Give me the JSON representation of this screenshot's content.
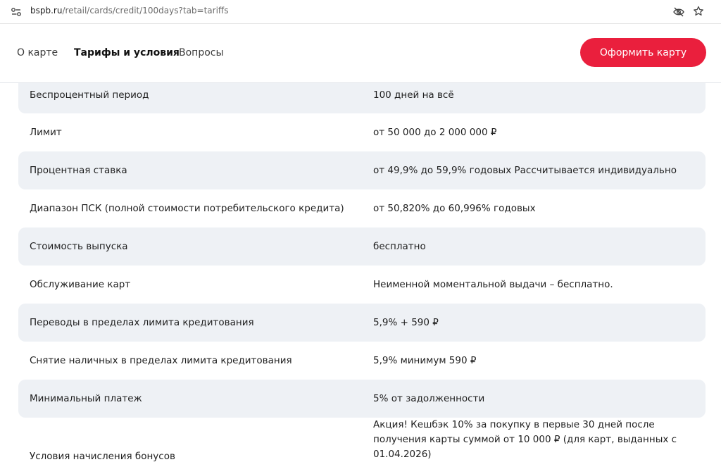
{
  "browser": {
    "url_host": "bspb.ru",
    "url_path": "/retail/cards/credit/100days?tab=tariffs"
  },
  "header": {
    "tabs": [
      {
        "label": "О карте"
      },
      {
        "label": "Тарифы и условия"
      },
      {
        "label": "Вопросы"
      }
    ],
    "cta_label": "Оформить карту"
  },
  "tariffs": [
    {
      "label": "Беспроцентный период",
      "value": "100 дней на всё"
    },
    {
      "label": "Лимит",
      "value": "от 50 000 до 2 000 000 ₽"
    },
    {
      "label": "Процентная ставка",
      "value": "от 49,9% до 59,9% годовых Рассчитывается индивидуально"
    },
    {
      "label": "Диапазон ПСК  (полной стоимости потребительского кредита)",
      "value": "от 50,820% до 60,996% годовых"
    },
    {
      "label": "Стоимость выпуска",
      "value": "бесплатно"
    },
    {
      "label": "Обслуживание карт",
      "value": "Неименной моментальной выдачи – бесплатно."
    },
    {
      "label": "Переводы в пределах лимита кредитования",
      "value": "5,9% + 590 ₽"
    },
    {
      "label": "Снятие наличных в пределах лимита кредитования",
      "value": "5,9% минимум 590 ₽"
    },
    {
      "label": "Минимальный платеж",
      "value": "5% от задолженности"
    },
    {
      "label": "Условия начисления бонусов",
      "value": "Акция! Кешбэк 10% за покупку в первые 30 дней после получения карты суммой от 10 000 ₽ (для карт, выданных с 01.04.2026)"
    }
  ],
  "colors": {
    "accent": "#ea1f3d",
    "row_shade": "#eef1f5"
  }
}
